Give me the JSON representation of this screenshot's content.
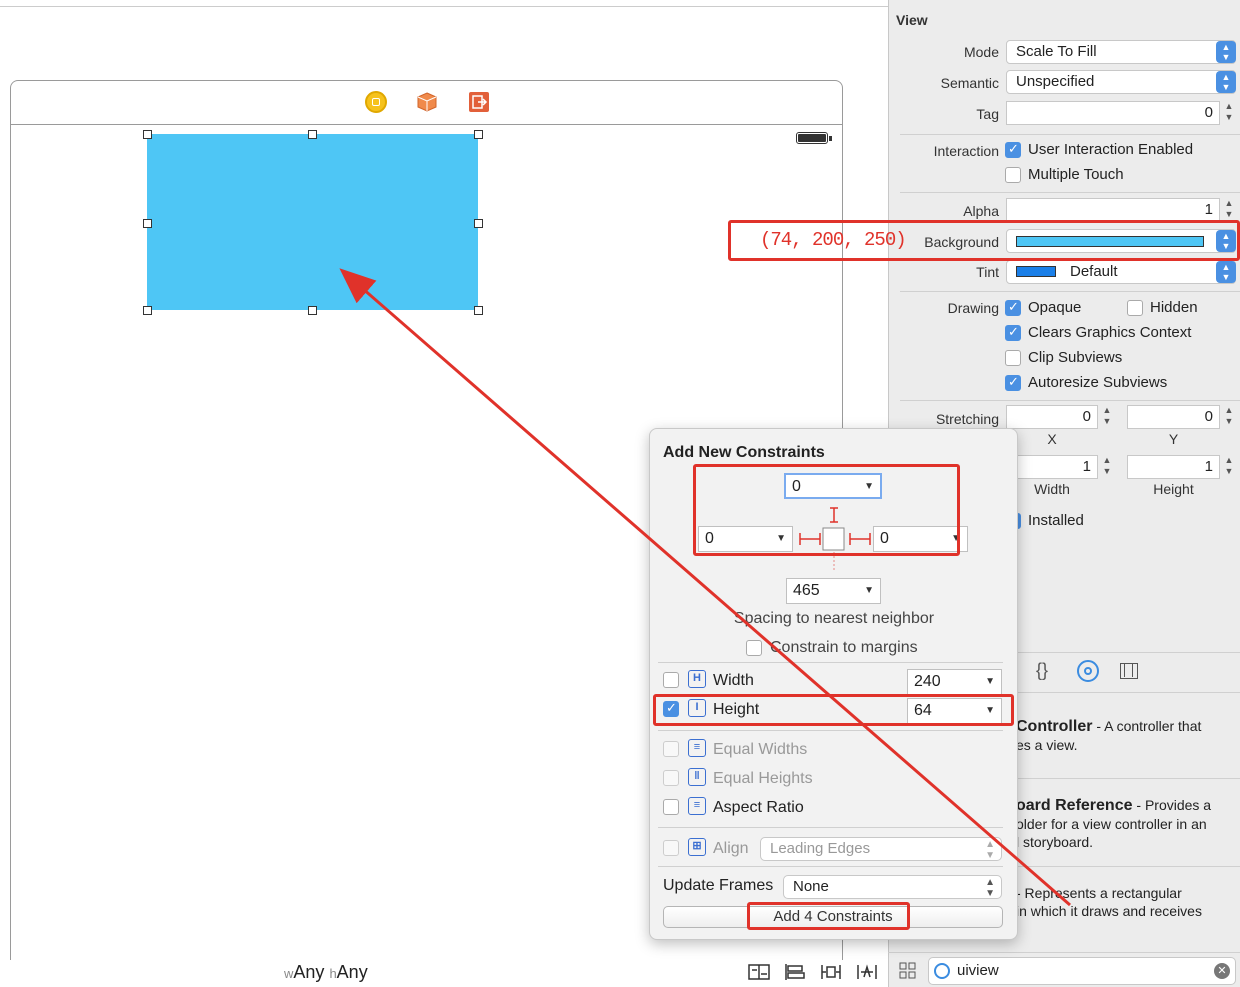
{
  "canvas": {
    "size_class_w_prefix": "w",
    "size_class_w": "Any",
    "size_class_h_prefix": "h",
    "size_class_h": "Any"
  },
  "annotation": {
    "rgb_text": "(74, 200, 250)"
  },
  "inspector": {
    "section_title": "View",
    "mode_label": "Mode",
    "mode_value": "Scale To Fill",
    "semantic_label": "Semantic",
    "semantic_value": "Unspecified",
    "tag_label": "Tag",
    "tag_value": "0",
    "interaction_label": "Interaction",
    "user_interaction": "User Interaction Enabled",
    "multiple_touch": "Multiple Touch",
    "alpha_label": "Alpha",
    "alpha_value": "1",
    "background_label": "Background",
    "background_color": "#4ec6f5",
    "tint_label": "Tint",
    "tint_value": "Default",
    "tint_color": "#1a7fe8",
    "drawing_label": "Drawing",
    "opaque": "Opaque",
    "hidden": "Hidden",
    "clears_graphics": "Clears Graphics Context",
    "clip_subviews": "Clip Subviews",
    "autoresize": "Autoresize Subviews",
    "stretching_label": "Stretching",
    "stretch_x": "0",
    "stretch_y": "0",
    "stretch_w": "1",
    "stretch_h": "1",
    "x_label": "X",
    "y_label": "Y",
    "width_label": "Width",
    "height_label": "Height",
    "installed": "Installed"
  },
  "library": {
    "item1_title": "Controller",
    "item1_text_a": " - A controller that",
    "item1_text_b": "es a view.",
    "item2_title": "oard Reference",
    "item2_text_a": " - Provides a",
    "item2_text_b": "older for a view controller in an",
    "item2_text_c": "l storyboard.",
    "item3_text_a": "- Represents a rectangular",
    "item3_text_b": "in which it draws and receives",
    "search_value": "uiview"
  },
  "popover": {
    "title": "Add New Constraints",
    "top_value": "0",
    "left_value": "0",
    "right_value": "0",
    "bottom_value": "465",
    "spacing_text": "Spacing to nearest neighbor",
    "constrain_margins": "Constrain to margins",
    "width_label": "Width",
    "width_value": "240",
    "height_label": "Height",
    "height_value": "64",
    "equal_widths": "Equal Widths",
    "equal_heights": "Equal Heights",
    "aspect_ratio": "Aspect Ratio",
    "align_label": "Align",
    "align_value": "Leading Edges",
    "update_frames_label": "Update Frames",
    "update_frames_value": "None",
    "add_button": "Add 4 Constraints"
  }
}
